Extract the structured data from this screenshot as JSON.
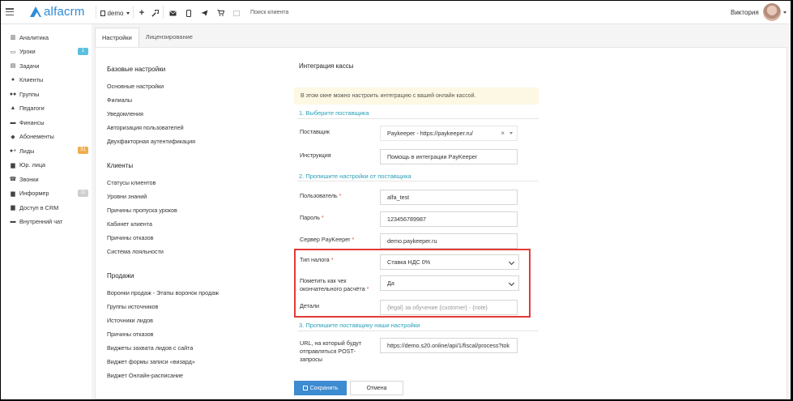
{
  "topbar": {
    "logo_text": "alfacrm",
    "branch_selector": "demo",
    "search_placeholder": "Поиск клиента",
    "user_name": "Виктория"
  },
  "sidebar": {
    "items": [
      {
        "label": "Аналитика",
        "icon": "bar-chart-icon"
      },
      {
        "label": "Уроки",
        "icon": "calendar-icon",
        "badge": "1",
        "badge_color": "#5bc0de"
      },
      {
        "label": "Задачи",
        "icon": "tasks-icon"
      },
      {
        "label": "Клиенты",
        "icon": "user-icon"
      },
      {
        "label": "Группы",
        "icon": "users-icon"
      },
      {
        "label": "Педагоги",
        "icon": "graduation-cap-icon"
      },
      {
        "label": "Финансы",
        "icon": "money-icon"
      },
      {
        "label": "Абонементы",
        "icon": "tag-icon"
      },
      {
        "label": "Лиды",
        "icon": "user-plus-icon",
        "badge": "31",
        "badge_color": "#f0ad4e"
      },
      {
        "label": "Юр. лица",
        "icon": "briefcase-icon"
      },
      {
        "label": "Звонки",
        "icon": "phone-icon"
      },
      {
        "label": "Информер",
        "icon": "inbox-icon",
        "badge": "11",
        "badge_color": "#cfcfcf"
      },
      {
        "label": "Доступ в CRM",
        "icon": "lock-icon"
      },
      {
        "label": "Внутренний чат",
        "icon": "chat-icon"
      }
    ]
  },
  "tabs": [
    {
      "label": "Настройки",
      "active": true
    },
    {
      "label": "Лицензирование",
      "active": false
    }
  ],
  "settings_menu": {
    "basic_title": "Базовые настройки",
    "basic_items": [
      "Основные настройки",
      "Филиалы",
      "Уведомления",
      "Авторизация пользователей",
      "Двухфакторная аутентификация"
    ],
    "clients_title": "Клиенты",
    "clients_items": [
      "Статусы клиентов",
      "Уровни знаний",
      "Причины пропуска уроков",
      "Кабинет клиента",
      "Причины отказов",
      "Система лояльности"
    ],
    "sales_title": "Продажи",
    "sales_items": [
      "Воронки продаж - Этапы воронок продаж",
      "Группы источников",
      "Источники лидов",
      "Причины отказов",
      "Виджеты захвата лидов с сайта",
      "Виджет формы записи «визард»",
      "Виджет Онлайн-расписание"
    ]
  },
  "form": {
    "title": "Интеграция кассы",
    "info": "В этом окне можно настроить интеграцию с вашей онлайн кассой.",
    "step1": "1. Выберите поставщика",
    "provider_label": "Поставщик",
    "provider_value": "Paykeeper - https://paykeeper.ru/",
    "instruction_label": "Инструкция",
    "instruction_value": "Помощь в интеграции PayKeeper",
    "step2": "2. Пропишите настройки от поставщика",
    "user_label": "Пользователь",
    "user_value": "alfa_test",
    "password_label": "Пароль",
    "password_value": "123456789987",
    "server_label": "Сервер PayKeeper",
    "server_value": "demo.paykeeper.ru",
    "tax_label": "Тип налога",
    "tax_value": "Ставка НДС 0%",
    "final_receipt_label_1": "Пометить как чек",
    "final_receipt_label_2": "окончательного расчёта",
    "final_receipt_value": "Да",
    "details_label": "Детали",
    "details_placeholder": "{legal} за обучение {customer} - {note}",
    "step3": "3. Пропишите поставщику наши настройки",
    "url_label_1": "URL, на который будут",
    "url_label_2": "отправляться POST-",
    "url_label_3": "запросы",
    "url_value": "https://demo.s20.online/api/1/fiscal/process?tok",
    "save_label": "Сохранить",
    "cancel_label": "Отмена",
    "required_mark": "*"
  },
  "colors": {
    "accent": "#3d8bd0",
    "step_text": "#2aa0b8",
    "highlight_border": "#e53935",
    "info_bg": "#fcf8e3"
  }
}
